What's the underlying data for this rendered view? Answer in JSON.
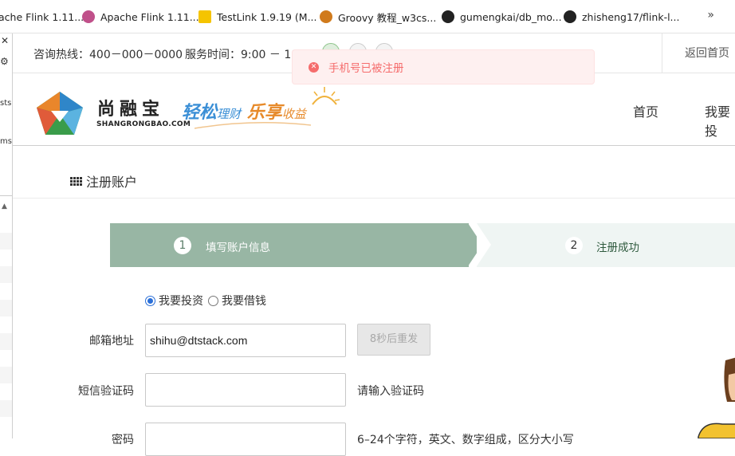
{
  "bookmarks": [
    {
      "label": "ache Flink 1.11...",
      "color": "#e65f5f"
    },
    {
      "label": "Apache Flink 1.11...",
      "color": "#c0508a"
    },
    {
      "label": "TestLink 1.9.19 (M...",
      "color": "#222222"
    },
    {
      "label": "Groovy 教程_w3cs...",
      "color": "#d07a1c"
    },
    {
      "label": "gumengkai/db_mo...",
      "color": "#222222"
    },
    {
      "label": "zhisheng17/flink-l...",
      "color": "#222222"
    }
  ],
  "bookmarks_more": "»",
  "sidebar": {
    "close": "✕",
    "gear": "⚙",
    "text1": "sts",
    "text2": "ms",
    "arrow": "▲"
  },
  "topbar": {
    "hotline": "咨询热线：400－000－0000",
    "service": "服务时间：9:00 － 18:",
    "back_home": "返回首页"
  },
  "toast": {
    "icon": "✕",
    "message": "手机号已被注册",
    "color": "#f56c6c"
  },
  "brand": {
    "name_cn": "尚融宝",
    "name_en": "SHANGRONGBAO.COM",
    "slogan_1": "轻松",
    "slogan_2": "理财",
    "slogan_3": "乐享",
    "slogan_4": "收益"
  },
  "nav": {
    "home": "首页",
    "invest": "我要投"
  },
  "section": {
    "title": "注册账户"
  },
  "steps": [
    {
      "num": "1",
      "label": "填写账户信息",
      "active": true
    },
    {
      "num": "2",
      "label": "注册成功",
      "active": false
    }
  ],
  "user_type": {
    "invest": "我要投资",
    "borrow": "我要借钱",
    "selected": "invest"
  },
  "form": {
    "email_label": "邮箱地址",
    "email_value": "shihu@dtstack.com",
    "resend_label": "8秒后重发",
    "sms_label": "短信验证码",
    "sms_value": "",
    "sms_hint": "请输入验证码",
    "password_label": "密码",
    "password_hint": "6–24个字符，英文、数字组成，区分大小写"
  },
  "colors": {
    "step_active": "#98b6a4",
    "step_inactive": "#eff5f3",
    "radio": "#2a6fd8"
  }
}
